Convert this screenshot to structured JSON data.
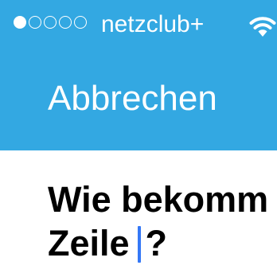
{
  "status_bar": {
    "signal_strength_filled": 1,
    "signal_strength_total": 5,
    "carrier": "netzclub+",
    "wifi_icon": "wifi-icon"
  },
  "nav": {
    "cancel_label": "Abbrechen"
  },
  "editor": {
    "line1": "Wie bekomm",
    "line2_before_caret": "Zeile",
    "line2_after_caret": "?"
  },
  "colors": {
    "header_background": "#33a8e2",
    "caret": "#3478f6",
    "text": "#000000"
  }
}
